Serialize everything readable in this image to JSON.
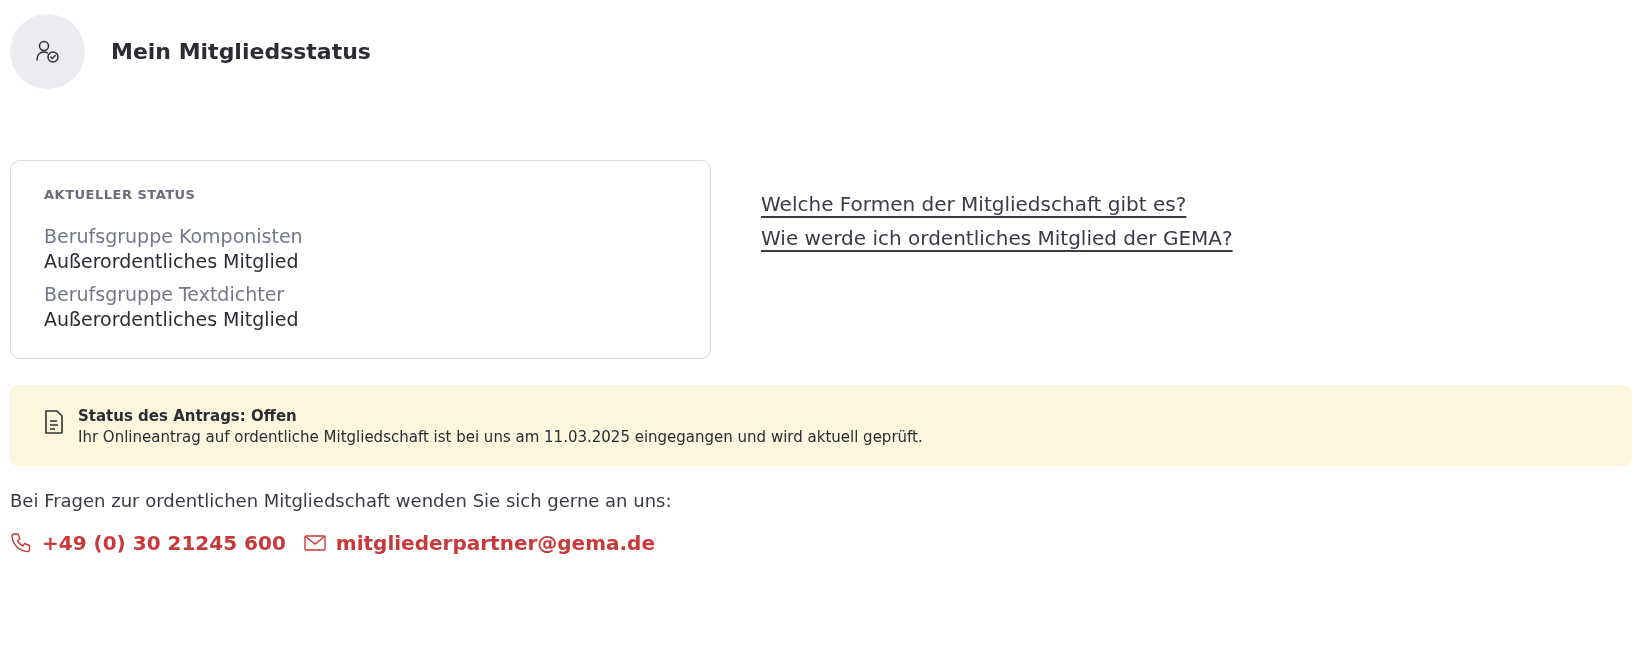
{
  "header": {
    "title": "Mein Mitgliedsstatus"
  },
  "status_card": {
    "heading": "AKTUELLER STATUS",
    "groups": [
      {
        "label": "Berufsgruppe Komponisten",
        "value": "Außerordentliches Mitglied"
      },
      {
        "label": "Berufsgruppe Textdichter",
        "value": "Außerordentliches Mitglied"
      }
    ]
  },
  "links": [
    "Welche Formen der Mitgliedschaft gibt es?",
    "Wie werde ich ordentliches Mitglied der GEMA?"
  ],
  "notice": {
    "title": "Status des Antrags: Offen",
    "text": "Ihr Onlineantrag auf ordentliche Mitgliedschaft ist bei uns am 11.03.2025 eingegangen und wird aktuell geprüft."
  },
  "contact": {
    "intro": "Bei Fragen zur ordentlichen Mitgliedschaft wenden Sie sich gerne an uns:",
    "items": [
      {
        "kind": "phone",
        "text": "+49 (0) 30 21245 600"
      },
      {
        "kind": "email",
        "text": "mitgliederpartner@gema.de"
      }
    ]
  }
}
